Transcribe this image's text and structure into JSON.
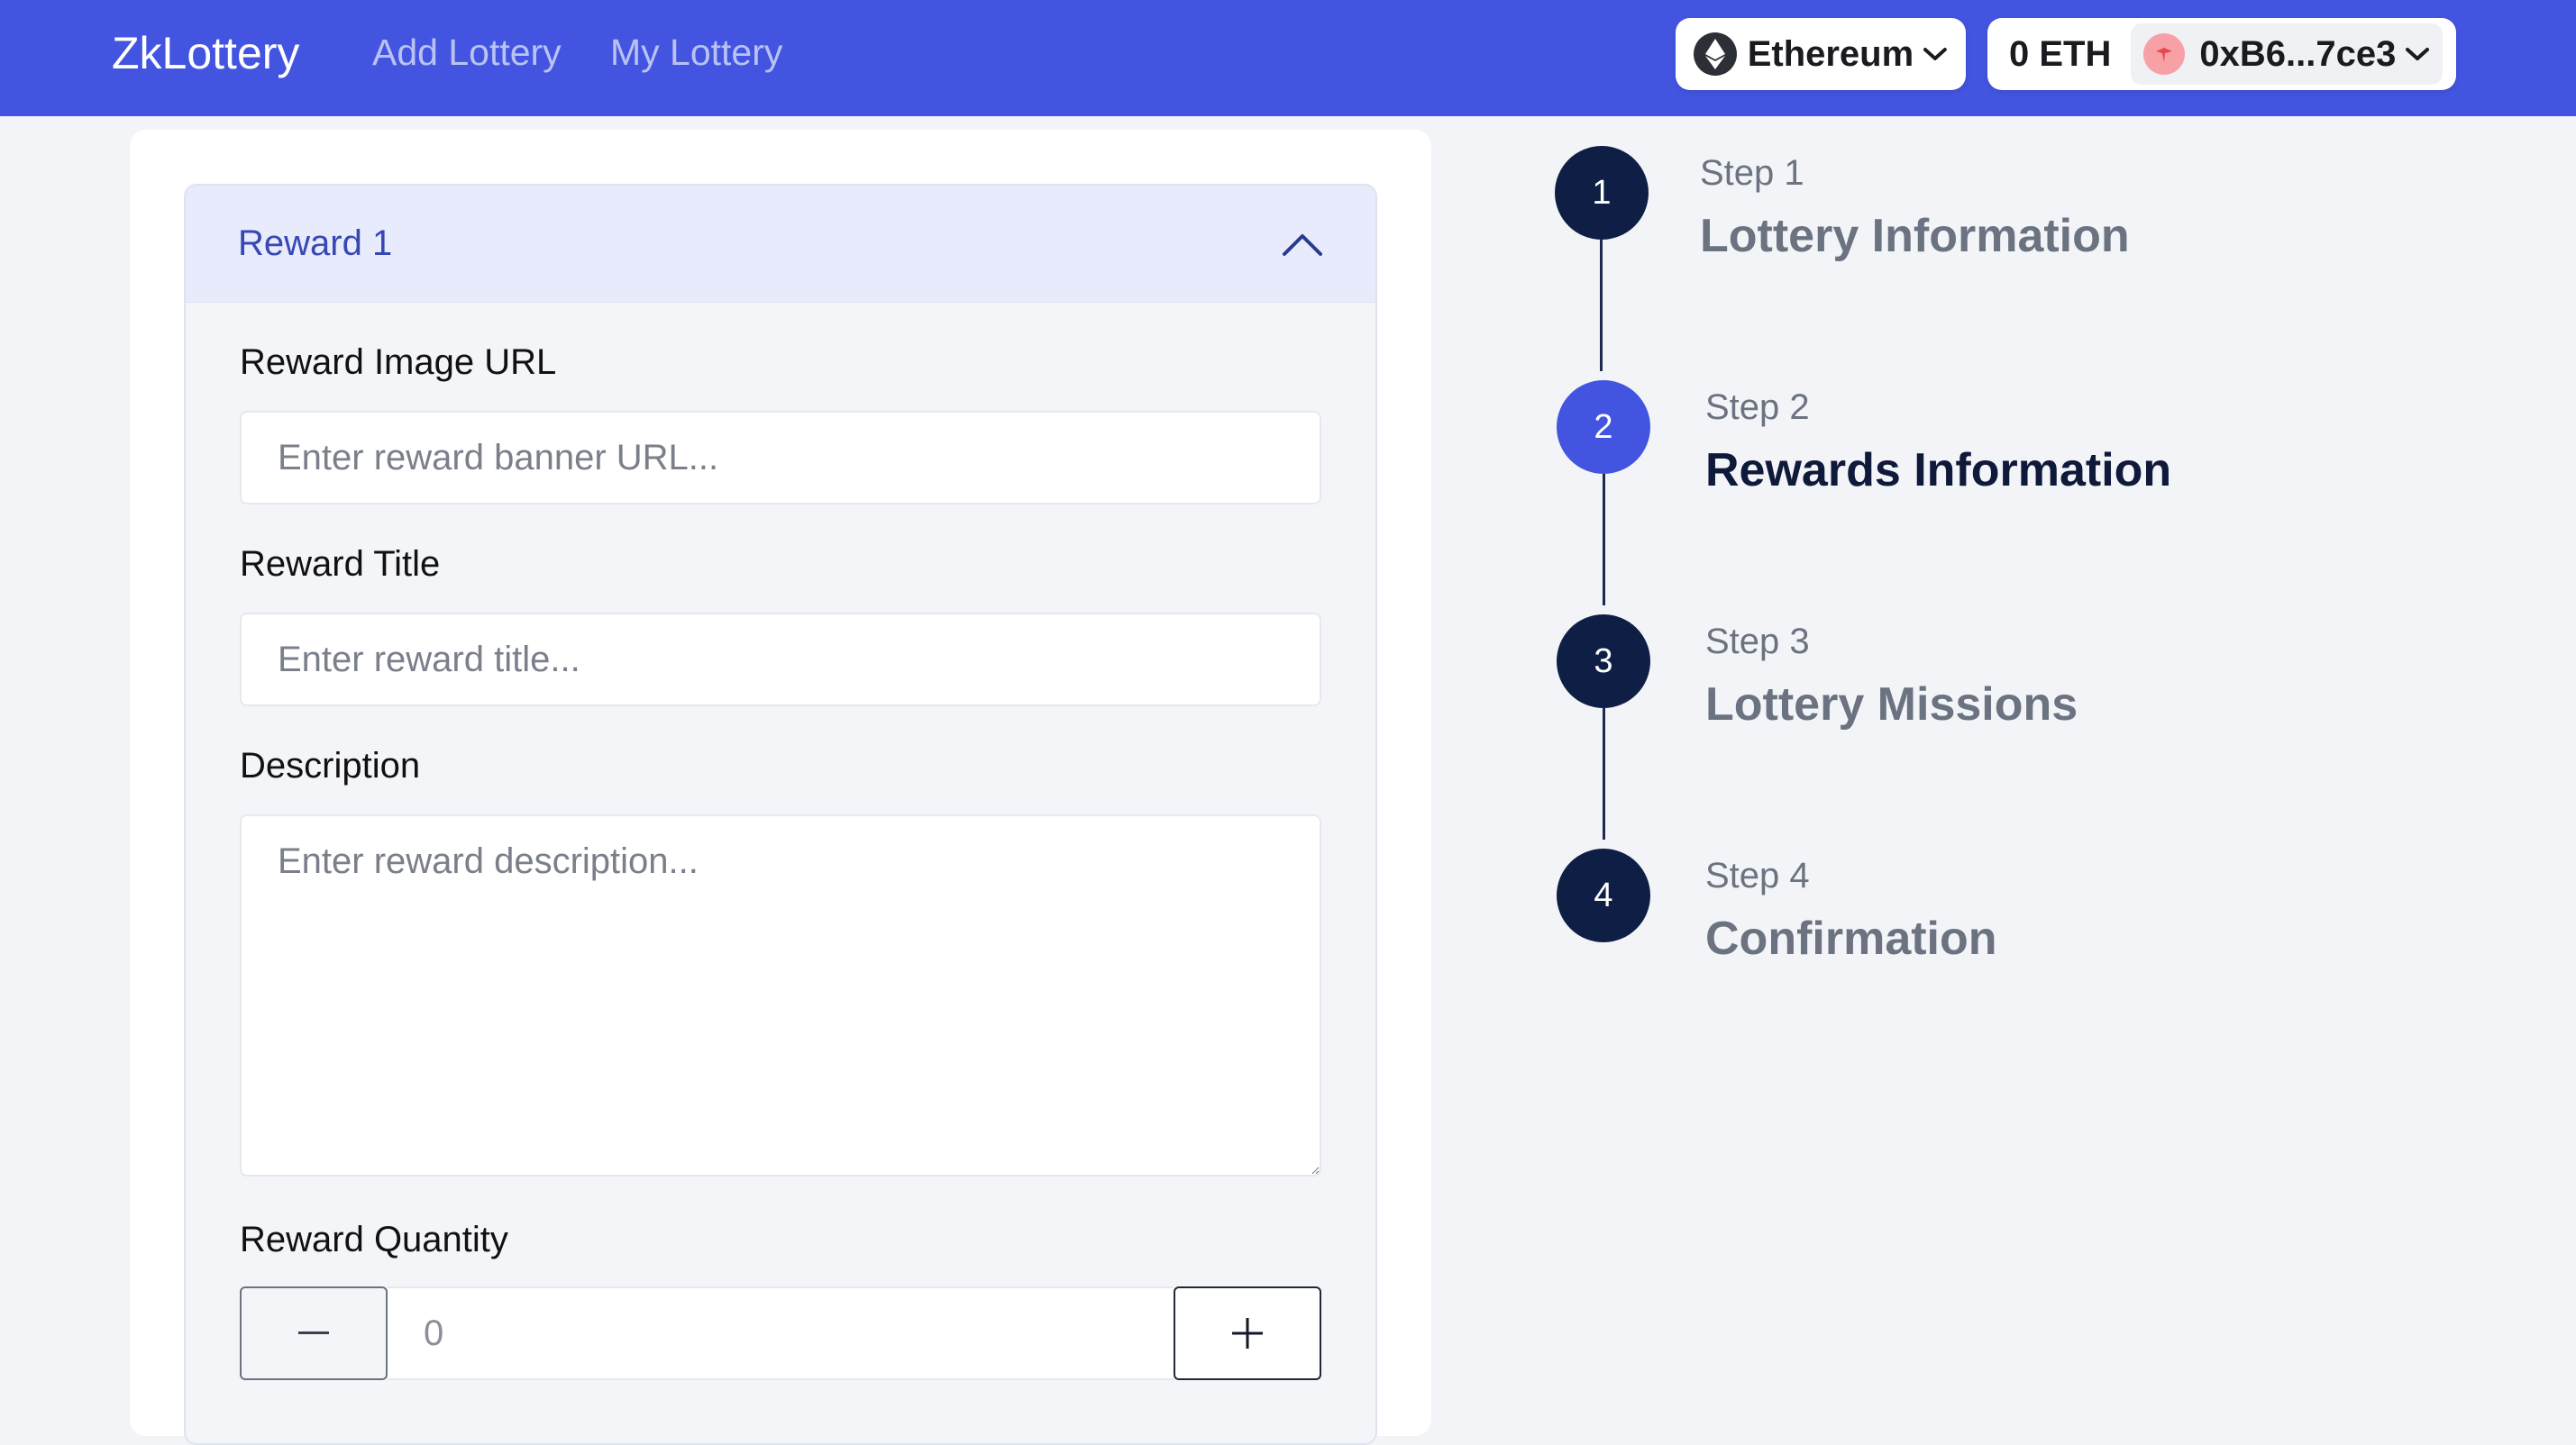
{
  "nav": {
    "brand": "ZkLottery",
    "links": [
      "Add Lottery",
      "My Lottery"
    ]
  },
  "wallet": {
    "network": "Ethereum",
    "balance": "0 ETH",
    "address": "0xB6...7ce3"
  },
  "reward": {
    "title": "Reward 1",
    "image_label": "Reward Image URL",
    "image_placeholder": "Enter reward banner URL...",
    "title_label": "Reward Title",
    "title_placeholder": "Enter reward title...",
    "description_label": "Description",
    "description_placeholder": "Enter reward description...",
    "quantity_label": "Reward Quantity",
    "quantity_value": "0"
  },
  "steps": [
    {
      "number": "1",
      "label": "Step 1",
      "title": "Lottery Information",
      "active": false
    },
    {
      "number": "2",
      "label": "Step 2",
      "title": "Rewards Information",
      "active": true
    },
    {
      "number": "3",
      "label": "Step 3",
      "title": "Lottery Missions",
      "active": false
    },
    {
      "number": "4",
      "label": "Step 4",
      "title": "Confirmation",
      "active": false
    }
  ],
  "colors": {
    "primary": "#4355e0",
    "step_dark": "#0f1e45",
    "background": "#f3f4f8"
  }
}
